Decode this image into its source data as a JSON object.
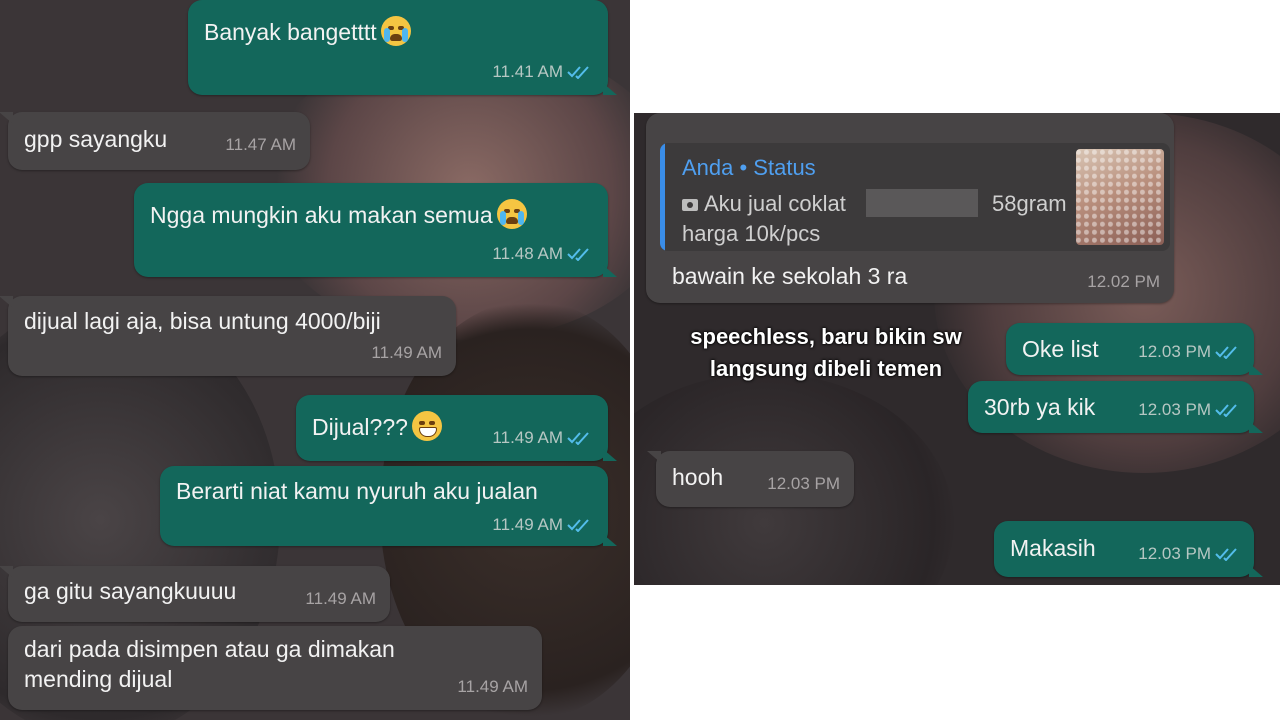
{
  "left_chat": {
    "messages": [
      {
        "text": "Banyak bangetttt",
        "emoji": "loudly-crying-face",
        "time": "11.41 AM",
        "direction": "outgoing",
        "status": "read"
      },
      {
        "text": "gpp sayangku",
        "time": "11.47 AM",
        "direction": "incoming"
      },
      {
        "text": "Ngga mungkin aku makan semua",
        "emoji": "loudly-crying-face",
        "time": "11.48 AM",
        "direction": "outgoing",
        "status": "read"
      },
      {
        "text": "dijual lagi aja, bisa untung 4000/biji",
        "time": "11.49 AM",
        "direction": "incoming"
      },
      {
        "text": "Dijual???",
        "emoji": "grinning-face",
        "time": "11.49 AM",
        "direction": "outgoing",
        "status": "read"
      },
      {
        "text": "Berarti niat kamu nyuruh aku jualan",
        "time": "11.49 AM",
        "direction": "outgoing",
        "status": "read"
      },
      {
        "text": "ga gitu sayangkuuuu",
        "time": "11.49 AM",
        "direction": "incoming"
      },
      {
        "text": "dari pada disimpen atau ga dimakan\nmending dijual",
        "time": "11.49 AM",
        "direction": "incoming"
      }
    ]
  },
  "right_chat": {
    "reply": {
      "quote_sender": "Anda • Status",
      "quote_line1": "Aku jual coklat",
      "quote_weight": "58gram",
      "quote_line2": "harga 10k/pcs",
      "text": "bawain ke sekolah 3 ra",
      "time": "12.02 PM"
    },
    "caption": "speechless, baru bikin sw langsung dibeli temen",
    "messages": [
      {
        "text": "Oke list",
        "time": "12.03 PM",
        "direction": "outgoing",
        "status": "read"
      },
      {
        "text": "30rb ya kik",
        "time": "12.03 PM",
        "direction": "outgoing",
        "status": "read"
      },
      {
        "text": "hooh",
        "time": "12.03 PM",
        "direction": "incoming"
      },
      {
        "text": "Makasih",
        "time": "12.03 PM",
        "direction": "outgoing",
        "status": "read"
      }
    ]
  },
  "colors": {
    "outgoing_bubble": "#13675b",
    "incoming_bubble": "#474445",
    "read_ticks": "#53bdeb",
    "quote_accent": "#3a8de8"
  }
}
